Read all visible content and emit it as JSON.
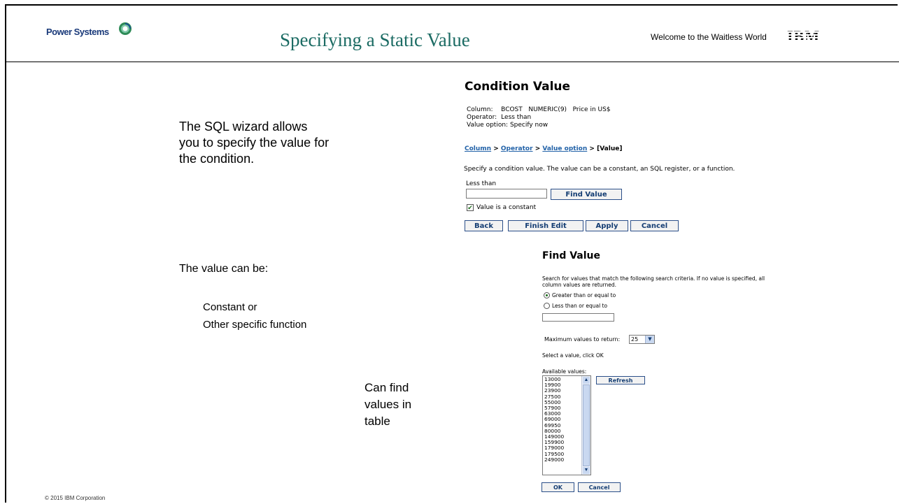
{
  "header": {
    "brand": "Power Systems",
    "title": "Specifying a Static Value",
    "welcome": "Welcome to the Waitless World",
    "ibm_logo": "IBM"
  },
  "notes": {
    "intro_line1": "The SQL wizard allows",
    "intro_line2": "you to specify the value for",
    "intro_line3": "the condition.",
    "value_can_be": "The value can be:",
    "option1": "Constant or",
    "option2": "Other specific function",
    "find_line1": "Can find",
    "find_line2": "values in",
    "find_line3": "table"
  },
  "footer": {
    "copyright": "© 2015 IBM Corporation"
  },
  "condition_value": {
    "title": "Condition Value",
    "column_label": "Column:",
    "column_value": "BCOST   NUMERIC(9)   Price in US$",
    "operator_label": "Operator:",
    "operator_value": "Less than",
    "value_option_label": "Value option:",
    "value_option_value": "Specify now",
    "breadcrumb": {
      "column": "Column",
      "operator": "Operator",
      "value_option": "Value option",
      "current": "[Value]",
      "sep": ">"
    },
    "description": "Specify a condition value. The value can be a constant, an SQL register, or a function.",
    "less_than_label": "Less than",
    "value_input": "",
    "find_value_button": "Find Value",
    "constant_checkbox_label": "Value is a constant",
    "constant_checked": true,
    "buttons": {
      "back": "Back",
      "finish_edit": "Finish Edit",
      "apply": "Apply",
      "cancel": "Cancel"
    }
  },
  "find_value": {
    "title": "Find Value",
    "description": "Search for values that match the following search criteria. If no value is specified, all column values are returned.",
    "radio_greater": "Greater than or equal to",
    "radio_less": "Less than or equal to",
    "selected_radio": "greater",
    "search_input": "",
    "max_values_label": "Maximum values to return:",
    "max_values": "25",
    "select_hint": "Select a value, click OK",
    "available_label": "Available values:",
    "available_values": [
      "13000",
      "19900",
      "23900",
      "27500",
      "55000",
      "57900",
      "63000",
      "69000",
      "69950",
      "80000",
      "149000",
      "159900",
      "179000",
      "179500",
      "249000"
    ],
    "refresh_button": "Refresh",
    "ok_button": "OK",
    "cancel_button": "Cancel"
  },
  "colors": {
    "title_teal": "#1b6b63",
    "link_blue": "#2262a8",
    "button_text": "#143d73"
  },
  "icons": {
    "brand_globe": "power-systems-globe-icon",
    "scroll_up": "chevron-up-icon",
    "scroll_down": "chevron-down-icon",
    "dropdown": "chevron-down-icon"
  }
}
